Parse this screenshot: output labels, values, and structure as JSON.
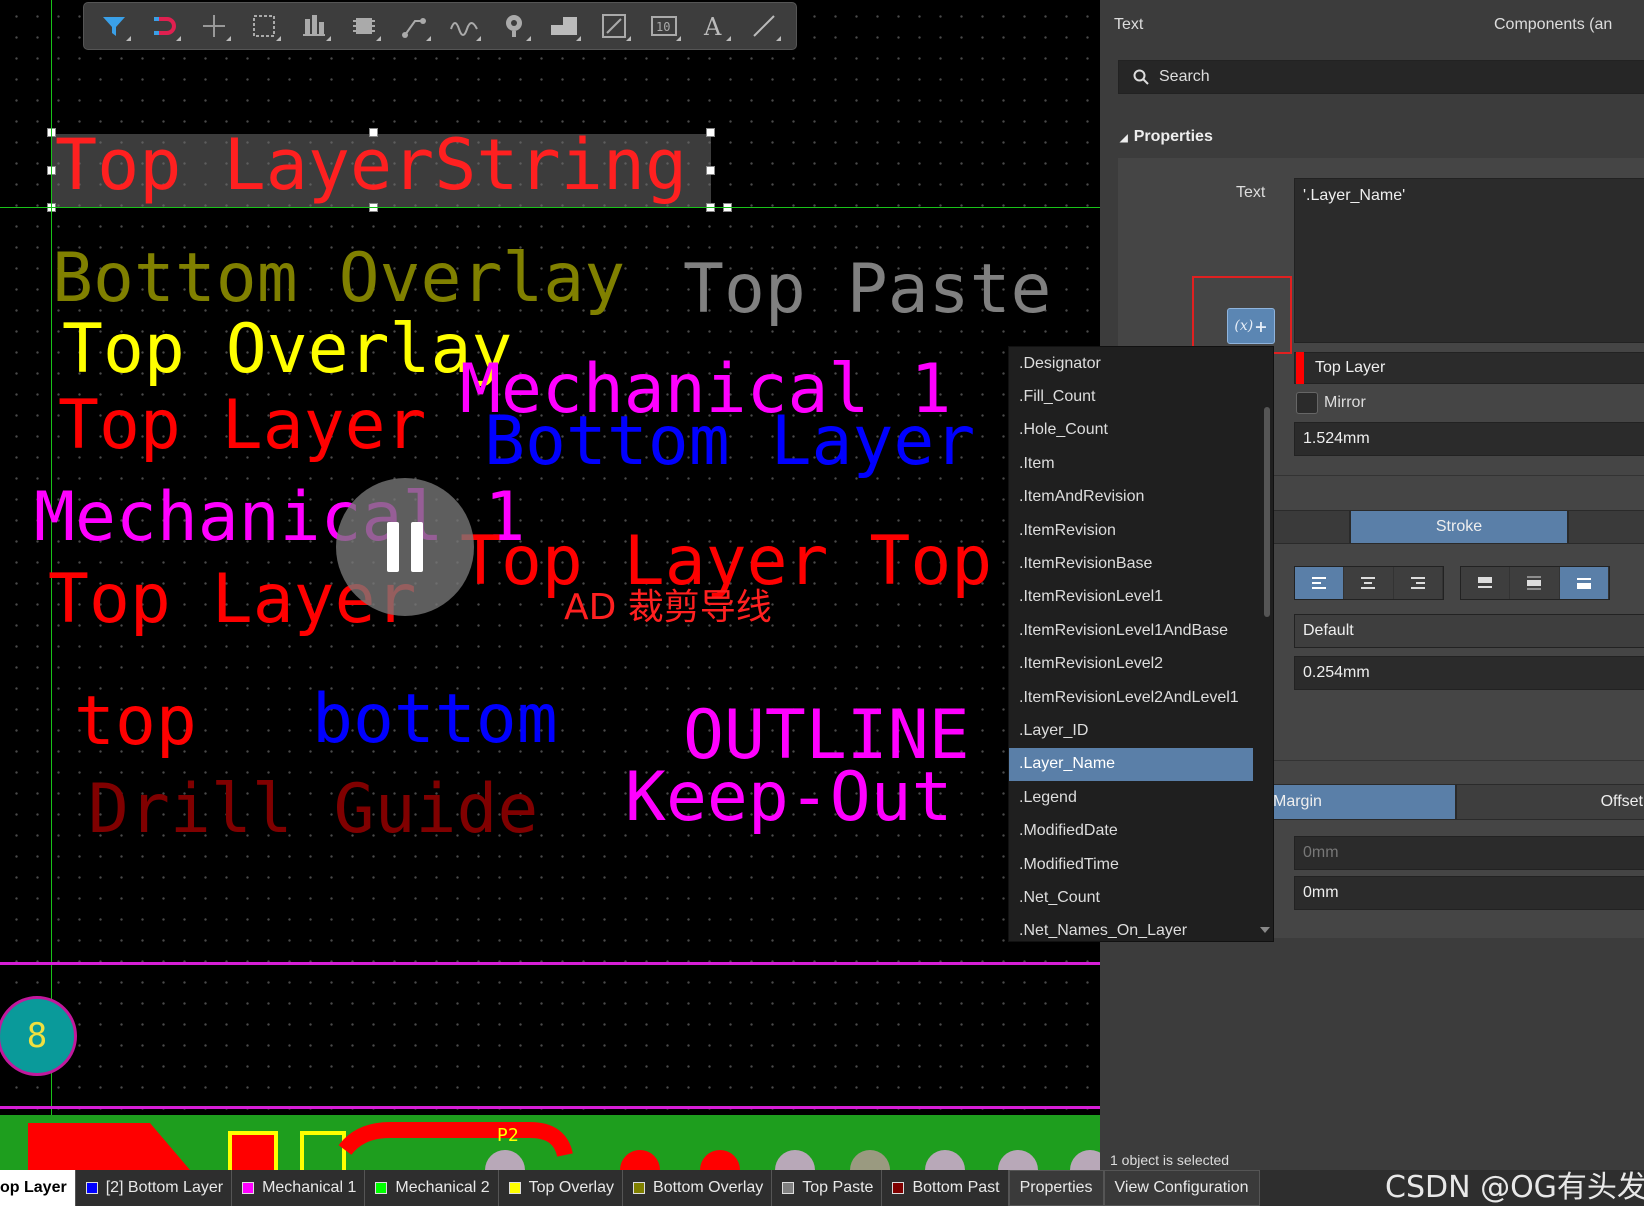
{
  "toolbar": {
    "icons": [
      "filter-icon",
      "snap-magnet-icon",
      "crosshair-icon",
      "select-rect-icon",
      "align-icon",
      "component-icon",
      "route-icon",
      "interactive-route-icon",
      "via-icon",
      "fill-icon",
      "dimension-icon",
      "string-number-icon",
      "text-icon",
      "line-icon"
    ]
  },
  "canvas": {
    "selected_text": "Top LayerString",
    "texts": [
      {
        "key": "bottom_overlay",
        "text": "Bottom Overlay",
        "color": "#808000"
      },
      {
        "key": "top_paste",
        "text": "Top Paste",
        "color": "#808080"
      },
      {
        "key": "top_overlay",
        "text": "Top Overlay",
        "color": "#ffff00"
      },
      {
        "key": "mechanical1_a",
        "text": "Mechanical 1",
        "color": "#ff00ff"
      },
      {
        "key": "top_layer_a",
        "text": "Top Layer",
        "color": "#ff0000"
      },
      {
        "key": "bottom_layer",
        "text": "Bottom Layer",
        "color": "#0000ff"
      },
      {
        "key": "mechanical1_b",
        "text": "Mechanical 1",
        "color": "#ff00ff"
      },
      {
        "key": "top_layer_top",
        "text": "Top Layer Top",
        "color": "#ff0000"
      },
      {
        "key": "top_layer_b",
        "text": "Top Layer",
        "color": "#ff0000"
      },
      {
        "key": "top_lower",
        "text": "top",
        "color": "#ff0000"
      },
      {
        "key": "bottom_lower",
        "text": "bottom",
        "color": "#0000ff"
      },
      {
        "key": "outline",
        "text": "OUTLINE",
        "color": "#ff00ff"
      },
      {
        "key": "drill_guide",
        "text": "Drill Guide",
        "color": "#800000"
      },
      {
        "key": "keep_out",
        "text": "Keep-Out",
        "color": "#ff00ff"
      }
    ],
    "caption": "AD 裁剪导线",
    "pad_label": "8",
    "net_label": "P2"
  },
  "panel": {
    "header_left": "Text",
    "header_right": "Components (an",
    "search_placeholder": "Search",
    "properties_title": "Properties",
    "text_label": "Text",
    "text_value": "'.Layer_Name'",
    "layer_value": "Top Layer",
    "mirror_label": "Mirror",
    "height_value": "1.524mm",
    "stroke_label": "Stroke",
    "font_value": "Default",
    "width_value": "0.254mm",
    "margin_label": "Margin",
    "offset_label": "Offset",
    "margin_value": "0mm",
    "offset_value": "0mm",
    "status": "1 object is selected"
  },
  "dropdown": {
    "items": [
      ".Designator",
      ".Fill_Count",
      ".Hole_Count",
      ".Item",
      ".ItemAndRevision",
      ".ItemRevision",
      ".ItemRevisionBase",
      ".ItemRevisionLevel1",
      ".ItemRevisionLevel1AndBase",
      ".ItemRevisionLevel2",
      ".ItemRevisionLevel2AndLevel1",
      ".Layer_ID",
      ".Layer_Name",
      ".Legend",
      ".ModifiedDate",
      ".ModifiedTime",
      ".Net_Count",
      ".Net_Names_On_Layer"
    ],
    "selected": ".Layer_Name"
  },
  "statusbar": {
    "layers": [
      {
        "label": "op Layer",
        "color": "#ff0000",
        "bold": true
      },
      {
        "label": "[2] Bottom Layer",
        "color": "#0000ff"
      },
      {
        "label": "Mechanical 1",
        "color": "#ff00ff"
      },
      {
        "label": "Mechanical 2",
        "color": "#00ff00"
      },
      {
        "label": "Top Overlay",
        "color": "#ffff00"
      },
      {
        "label": "Bottom Overlay",
        "color": "#808000"
      },
      {
        "label": "Top Paste",
        "color": "#808080"
      },
      {
        "label": "Bottom Past",
        "color": "#800000"
      }
    ],
    "tabs": [
      "Properties",
      "View Configuration"
    ]
  },
  "watermark": "CSDN @OG有头发"
}
